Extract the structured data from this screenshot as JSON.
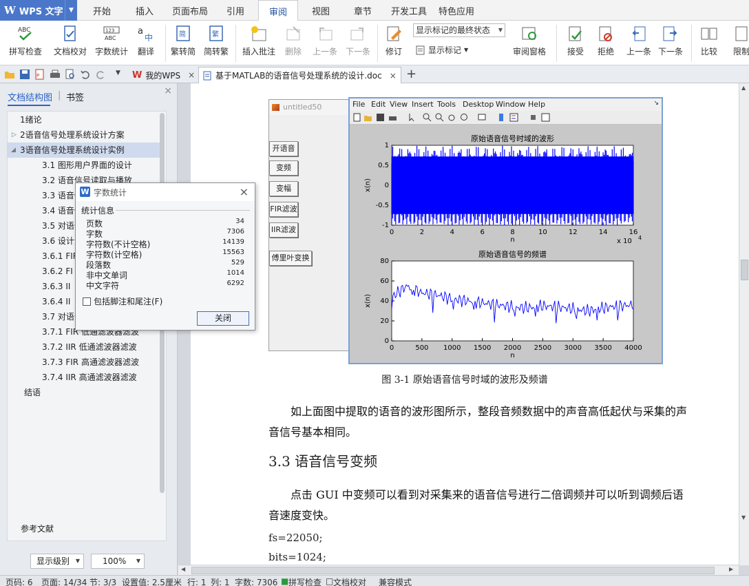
{
  "app": {
    "name": "WPS 文字"
  },
  "menu_tabs": [
    "开始",
    "插入",
    "页面布局",
    "引用",
    "审阅",
    "视图",
    "章节",
    "开发工具",
    "特色应用"
  ],
  "ribbon": {
    "spell_check": "拼写检查",
    "doc_proof": "文档校对",
    "word_count": "字数统计",
    "translate": "翻译",
    "to_simplified": "繁转简",
    "to_traditional": "简转繁",
    "insert_comment": "插入批注",
    "delete": "删除",
    "prev": "上一条",
    "next": "下一条",
    "revise": "修订",
    "markup_mode": "显示标记的最终状态",
    "show_marks": "显示标记",
    "review_pane": "审阅窗格",
    "accept": "接受",
    "reject": "拒绝",
    "prev2": "上一条",
    "next2": "下一条",
    "compare": "比较",
    "restrict": "限制"
  },
  "doc_tabs": {
    "home": "我的WPS",
    "doc": "基于MATLAB的语音信号处理系统的设计.doc"
  },
  "left_pane": {
    "tab_outline": "文档结构图",
    "tab_bookmark": "书签",
    "items": [
      "1绪论",
      "2语音信号处理系统设计方案",
      "3语音信号处理系统设计实例",
      "3.1 图形用户界面的设计",
      "3.2 语音信号读取与播放",
      "3.3 语音信",
      "3.4 语音信",
      "3.5 对语音",
      "3.6 设计滤",
      "3.6.1 FIR",
      "3.6.2 FI",
      "3.6.3 II",
      "3.6.4 II",
      "3.7 对语音",
      "3.7.1 FIR 低通滤波器滤波",
      "3.7.2 IIR 低通滤波器滤波",
      "3.7.3 FIR 高通滤波器滤波",
      "3.7.4 IIR 高通滤波器滤波",
      "结语",
      "参考文献"
    ],
    "level_select": "显示级别",
    "zoom": "100%"
  },
  "dialog": {
    "title": "字数统计",
    "group": "统计信息",
    "stats": [
      {
        "label": "页数",
        "value": "34"
      },
      {
        "label": "字数",
        "value": "7306"
      },
      {
        "label": "字符数(不计空格)",
        "value": "14139"
      },
      {
        "label": "字符数(计空格)",
        "value": "15563"
      },
      {
        "label": "段落数",
        "value": "529"
      },
      {
        "label": "非中文单词",
        "value": "1014"
      },
      {
        "label": "中文字符",
        "value": "6292"
      }
    ],
    "include_footnotes": "包括脚注和尾注(F)",
    "close": "关闭"
  },
  "figure": {
    "gui_title": "untitled50",
    "gui_buttons": [
      "开语音",
      "变频",
      "变幅",
      "FIR滤波",
      "IIR滤波",
      "傅里叶变换"
    ],
    "menu": [
      "File",
      "Edit",
      "View",
      "Insert",
      "Tools",
      "Desktop",
      "Window",
      "Help"
    ]
  },
  "chart_data": [
    {
      "type": "line",
      "title": "原始语音信号时域的波形",
      "xlabel": "n",
      "ylabel": "x(n)",
      "xlim": [
        0,
        160000
      ],
      "ylim": [
        -1,
        1
      ],
      "x_ticks": [
        "0",
        "2",
        "4",
        "6",
        "8",
        "10",
        "12",
        "14",
        "16"
      ],
      "y_ticks": [
        "-1",
        "-0.5",
        "0",
        "0.5",
        "1"
      ],
      "x_multiplier": "x 10",
      "x_multiplier_exp": "4",
      "color": "#0000ff",
      "series": [
        {
          "x": [
            0,
            10000,
            20000,
            30000,
            40000,
            50000,
            60000,
            70000,
            80000,
            90000,
            100000,
            110000,
            120000,
            130000,
            140000,
            150000,
            160000
          ],
          "upper": [
            1,
            0.98,
            1,
            0.97,
            1,
            0.98,
            1,
            0.99,
            1,
            0.98,
            1,
            0.97,
            1,
            0.98,
            1,
            0.99,
            0.9
          ],
          "lower": [
            -1,
            -0.98,
            -1,
            -0.97,
            -1,
            -0.98,
            -1,
            -0.99,
            -1,
            -0.98,
            -1,
            -0.97,
            -1,
            -0.98,
            -1,
            -0.99,
            -0.9
          ]
        }
      ]
    },
    {
      "type": "line",
      "title": "原始语音信号的频谱",
      "xlabel": "n",
      "ylabel": "x(n)",
      "xlim": [
        0,
        4000
      ],
      "ylim": [
        0,
        80
      ],
      "x_ticks": [
        "0",
        "500",
        "1000",
        "1500",
        "2000",
        "2500",
        "3000",
        "3500",
        "4000"
      ],
      "y_ticks": [
        "0",
        "20",
        "40",
        "60",
        "80"
      ],
      "color": "#0000ff",
      "series": [
        {
          "x": [
            0,
            250,
            500,
            750,
            1000,
            1250,
            1500,
            1750,
            2000,
            2250,
            2500,
            2750,
            3000,
            3250,
            3500,
            3750,
            4000
          ],
          "values": [
            44,
            55,
            48,
            46,
            42,
            40,
            38,
            36,
            34,
            33,
            35,
            34,
            32,
            30,
            33,
            35,
            36
          ]
        }
      ]
    }
  ],
  "document": {
    "caption": "图 3-1 原始语音信号时域的波形及频谱",
    "para1_line1": "如上面图中提取的语音的波形图所示，整段音频数据中的声音高低起伏与采集的声",
    "para1_line2": "音信号基本相同。",
    "heading": "3.3 语音信号变频",
    "para2_line1": "点击 GUI 中变频可以看到对采集来的语音信号进行二倍调频并可以听到调频后语",
    "para2_line2": "音速度变快。",
    "code1": "fs=22050;",
    "code2": "bits=1024;"
  },
  "status": {
    "page_num": "页码: 6",
    "pages": "页面: 14/34",
    "section": "节: 3/3",
    "setting": "设置值: 2.5厘米",
    "row": "行: 1",
    "col": "列: 1",
    "words": "字数: 7306",
    "spell": "拼写检查",
    "proof": "文档校对",
    "compat": "兼容模式"
  }
}
